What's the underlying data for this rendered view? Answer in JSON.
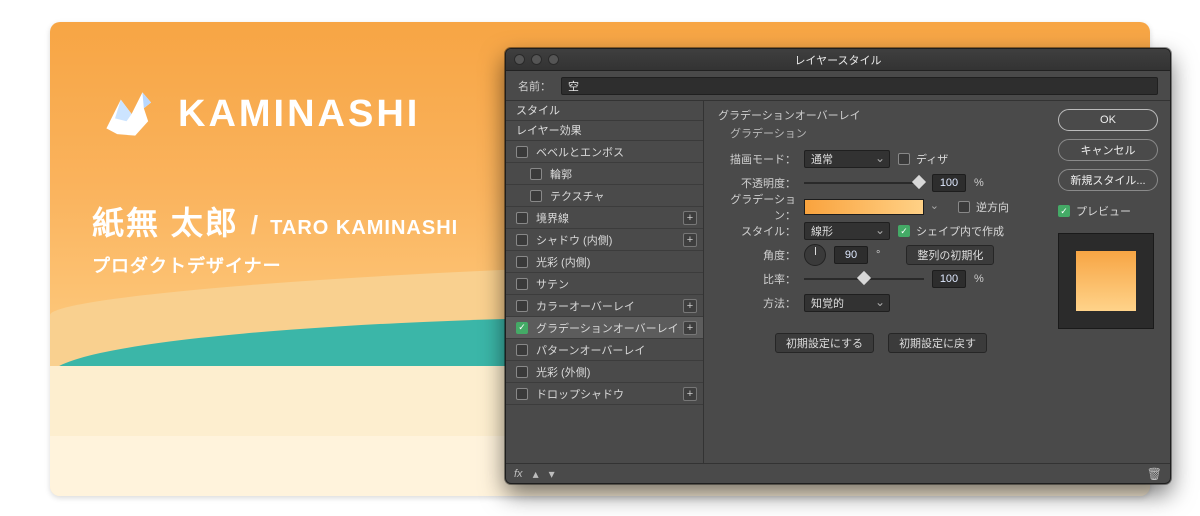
{
  "card": {
    "brand": "KAMINASHI",
    "name_jp": "紙無 太郎",
    "name_sep": "/",
    "name_en": "TARO KAMINASHI",
    "role": "プロダクトデザイナー"
  },
  "dialog": {
    "title": "レイヤースタイル",
    "name_label": "名前：",
    "name_value": "空",
    "style_header": "スタイル",
    "effects_header": "レイヤー効果",
    "rows": {
      "bevel": "ベベルとエンボス",
      "contour": "輪郭",
      "texture": "テクスチャ",
      "stroke": "境界線",
      "inner_shadow": "シャドウ (内側)",
      "inner_glow": "光彩 (内側)",
      "satin": "サテン",
      "color_overlay": "カラーオーバーレイ",
      "gradient_overlay": "グラデーションオーバーレイ",
      "pattern_overlay": "パターンオーバーレイ",
      "outer_glow": "光彩 (外側)",
      "drop_shadow": "ドロップシャドウ"
    },
    "panel": {
      "group_title": "グラデーションオーバーレイ",
      "group_sub": "グラデーション",
      "blend_label": "描画モード：",
      "blend_value": "通常",
      "dither_label": "ディザ",
      "opacity_label": "不透明度：",
      "opacity_value": "100",
      "percent": "%",
      "gradient_label": "グラデーション：",
      "reverse_label": "逆方向",
      "style_label": "スタイル：",
      "style_value": "線形",
      "align_label": "シェイプ内で作成",
      "angle_label": "角度：",
      "angle_value": "90",
      "degree": "°",
      "reset_align": "整列の初期化",
      "scale_label": "比率：",
      "scale_value": "100",
      "method_label": "方法：",
      "method_value": "知覚的",
      "make_default": "初期設定にする",
      "reset_default": "初期設定に戻す"
    },
    "buttons": {
      "ok": "OK",
      "cancel": "キャンセル",
      "new_style": "新規スタイル...",
      "preview": "プレビュー"
    },
    "footer": {
      "fx": "fx",
      "trash": "🗑"
    }
  }
}
